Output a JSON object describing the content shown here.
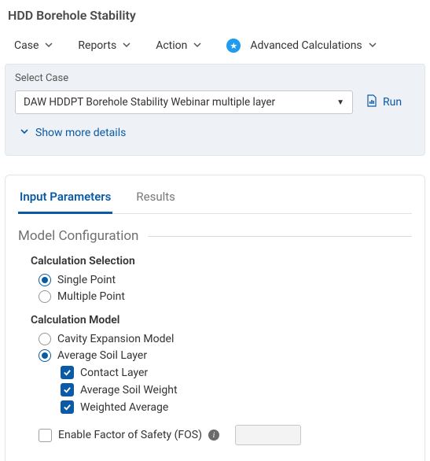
{
  "title": "HDD Borehole Stability",
  "menu": {
    "case": "Case",
    "reports": "Reports",
    "action": "Action",
    "advanced": "Advanced Calculations"
  },
  "select_case": {
    "label": "Select Case",
    "value": "DAW HDDPT Borehole Stability Webinar multiple layer",
    "run_label": "Run",
    "show_more": "Show more details"
  },
  "tabs": {
    "input": "Input Parameters",
    "results": "Results"
  },
  "model_config": {
    "legend": "Model Configuration",
    "calc_selection": {
      "label": "Calculation Selection",
      "single": "Single Point",
      "multiple": "Multiple Point"
    },
    "calc_model": {
      "label": "Calculation Model",
      "cavity": "Cavity Expansion Model",
      "average": "Average Soil Layer",
      "contact": "Contact Layer",
      "avg_weight": "Average Soil Weight",
      "weighted": "Weighted Average"
    },
    "fos": {
      "label": "Enable Factor of Safety (FOS)",
      "value": ""
    }
  }
}
